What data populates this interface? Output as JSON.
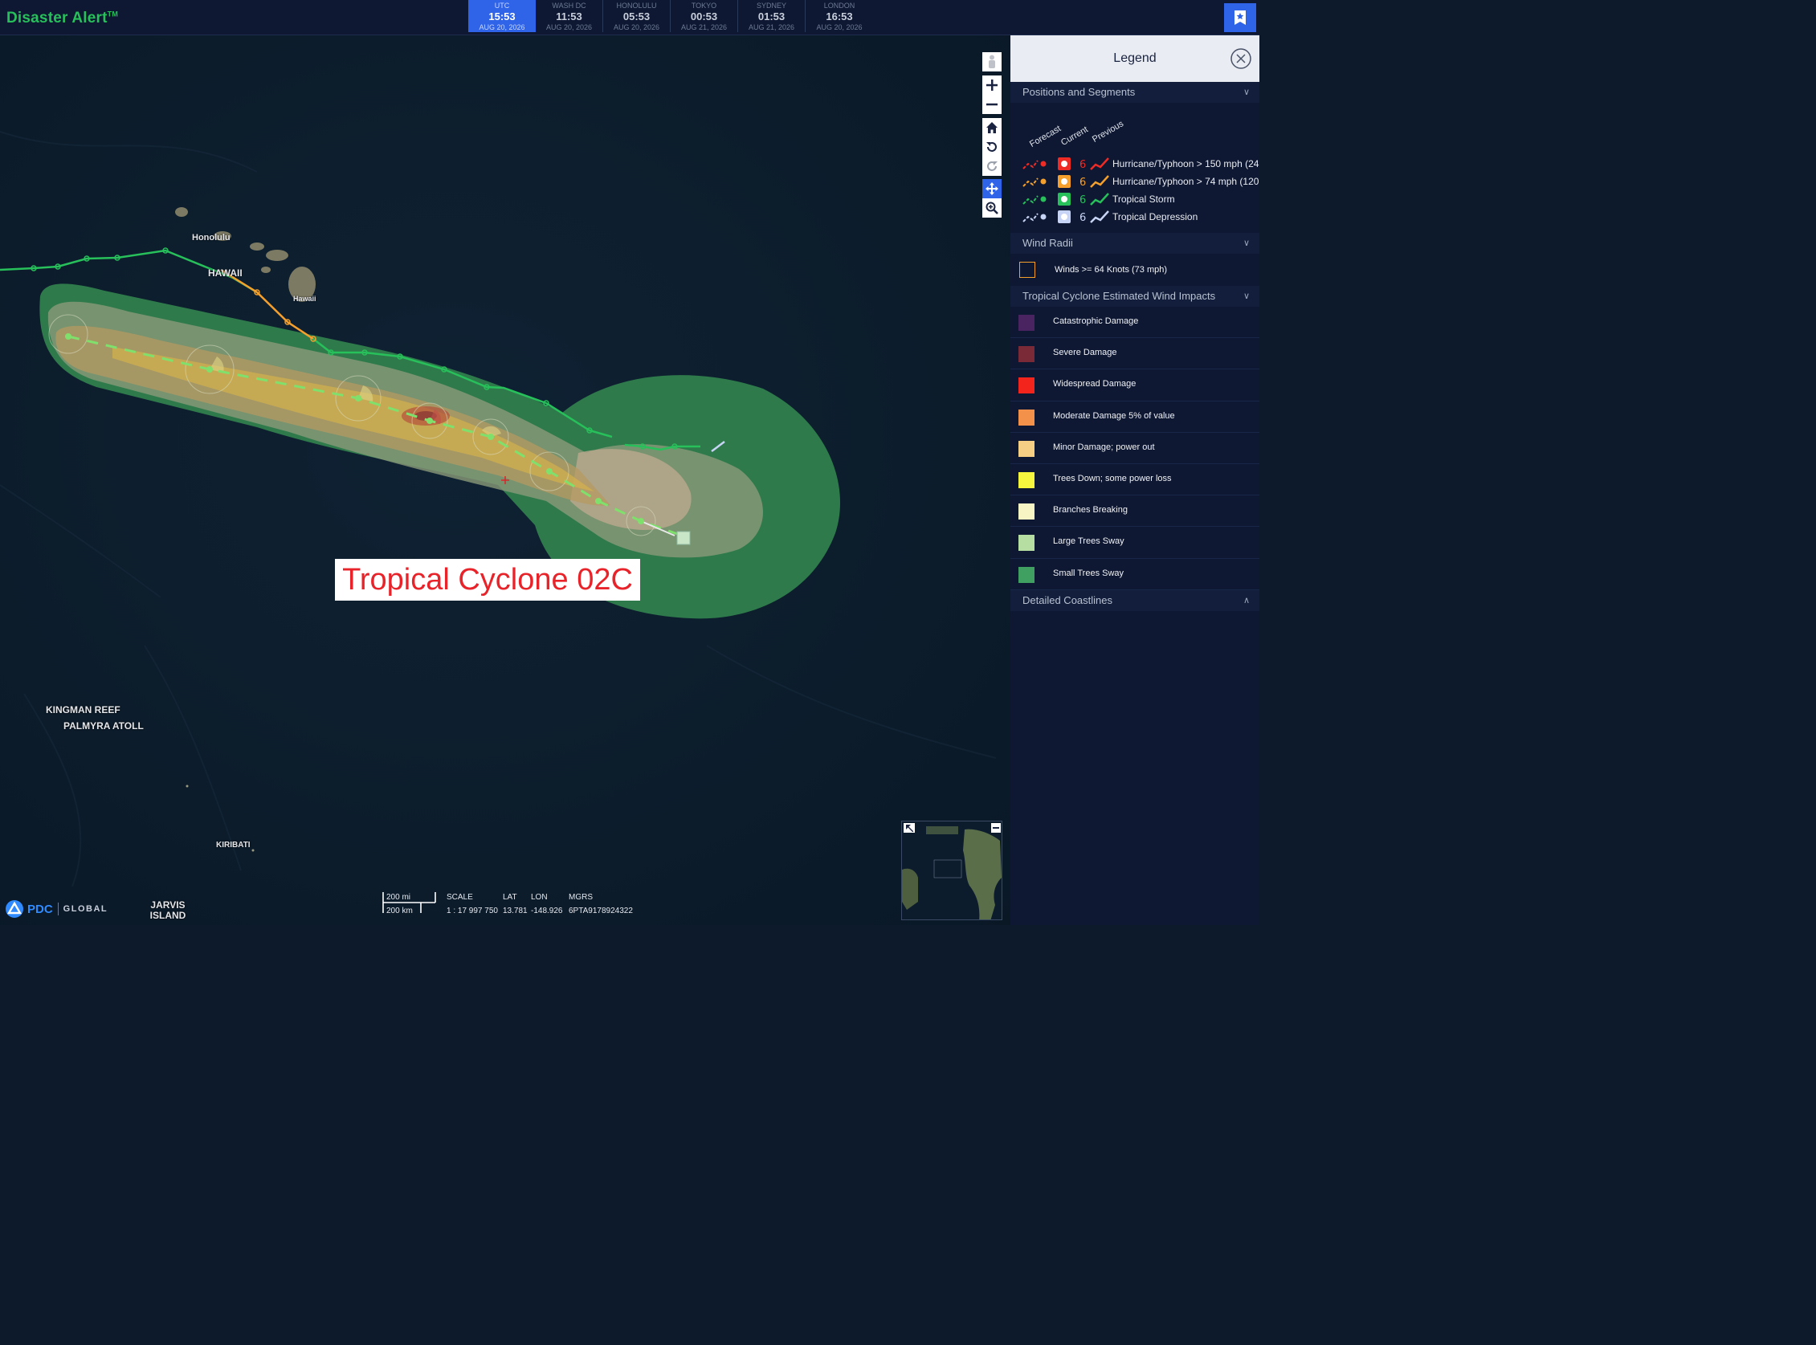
{
  "app": {
    "title": "Disaster Alert",
    "trademark": "TM"
  },
  "clocks": [
    {
      "city": "UTC",
      "time": "15:53",
      "date": "AUG 20, 2026",
      "active": true
    },
    {
      "city": "WASH DC",
      "time": "11:53",
      "date": "AUG 20, 2026",
      "active": false
    },
    {
      "city": "HONOLULU",
      "time": "05:53",
      "date": "AUG 20, 2026",
      "active": false
    },
    {
      "city": "TOKYO",
      "time": "00:53",
      "date": "AUG 21, 2026",
      "active": false
    },
    {
      "city": "SYDNEY",
      "time": "01:53",
      "date": "AUG 21, 2026",
      "active": false
    },
    {
      "city": "LONDON",
      "time": "16:53",
      "date": "AUG 20, 2026",
      "active": false
    }
  ],
  "map": {
    "labels": {
      "honolulu": "Honolulu",
      "hawaii_region": "HAWAII",
      "hawaii_island": "Hawaii",
      "kingman": "KINGMAN REEF",
      "palmyra": "PALMYRA ATOLL",
      "kiribati": "KIRIBATI",
      "jarvis": "JARVIS ISLAND"
    },
    "storm_title": "Tropical Cyclone 02C"
  },
  "status": {
    "scale_bar": {
      "mi": "200 mi",
      "km": "200 km"
    },
    "scale_label": "SCALE",
    "scale_value": "1 : 17 997 750",
    "lat_label": "LAT",
    "lat_value": "13.781",
    "lon_label": "LON",
    "lon_value": "-148.926",
    "mgrs_label": "MGRS",
    "mgrs_value": "6PTA9178924322"
  },
  "branding": {
    "pdc": "PDC",
    "global": "GLOBAL"
  },
  "legend": {
    "title": "Legend",
    "sections": {
      "positions": "Positions and Segments",
      "wind_radii": "Wind Radii",
      "wind_impacts": "Tropical Cyclone Estimated Wind Impacts",
      "coastlines": "Detailed Coastlines"
    },
    "column_heads": {
      "forecast": "Forecast",
      "current": "Current",
      "previous": "Previous"
    },
    "track_types": [
      {
        "label": "Hurricane/Typhoon > 150 mph (24",
        "color": "#ef2b25"
      },
      {
        "label": "Hurricane/Typhoon > 74 mph (120",
        "color": "#f5a02c"
      },
      {
        "label": "Tropical Storm",
        "color": "#27c05a"
      },
      {
        "label": "Tropical Depression",
        "color": "#c8d4f5"
      }
    ],
    "wind_radii_item": {
      "label": "Winds >= 64 Knots (73 mph)",
      "color": "#f5a02c"
    },
    "impacts": [
      {
        "label": "Catastrophic Damage",
        "color": "#4a2460"
      },
      {
        "label": "Severe Damage",
        "color": "#7a2a36"
      },
      {
        "label": "Widespread Damage",
        "color": "#f2241c"
      },
      {
        "label": "Moderate Damage 5% of value",
        "color": "#f3904a"
      },
      {
        "label": "Minor Damage; power out",
        "color": "#f6cf84"
      },
      {
        "label": "Trees Down; some power loss",
        "color": "#f7f63f"
      },
      {
        "label": "Branches Breaking",
        "color": "#f7f5c4"
      },
      {
        "label": "Large Trees Sway",
        "color": "#b6dea2"
      },
      {
        "label": "Small Trees Sway",
        "color": "#3fa062"
      }
    ]
  }
}
